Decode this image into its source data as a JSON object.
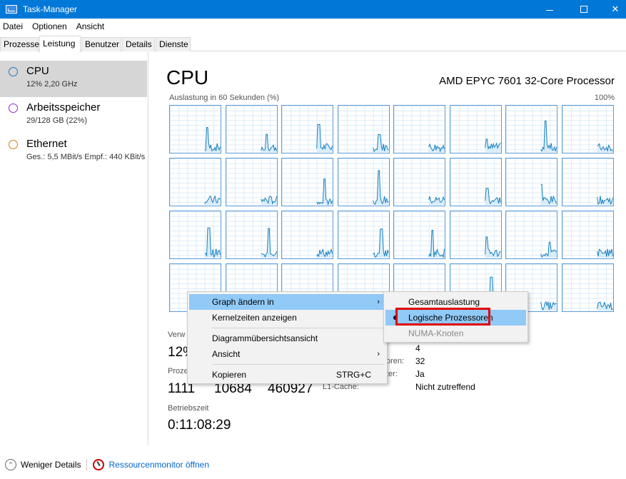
{
  "window": {
    "title": "Task-Manager"
  },
  "menubar": {
    "items": [
      "Datei",
      "Optionen",
      "Ansicht"
    ]
  },
  "tabs": [
    "Prozesse",
    "Leistung",
    "Benutzer",
    "Details",
    "Dienste"
  ],
  "sidebar": {
    "items": [
      {
        "name": "CPU",
        "sub": "12%  2,20 GHz",
        "color": "#1a7bc4"
      },
      {
        "name": "Arbeitsspeicher",
        "sub": "29/128 GB (22%)",
        "color": "#8b2fc9"
      },
      {
        "name": "Ethernet",
        "sub": "Ges.: 5,5 MBit/s  Empf.: 440 KBit/s",
        "color": "#d67a1c"
      }
    ]
  },
  "main": {
    "title": "CPU",
    "model": "AMD EPYC 7601 32-Core Processor",
    "graph_label": "Auslastung in 60 Sekunden (%)",
    "graph_max": "100%"
  },
  "stats": {
    "util_label": "Verw",
    "util_value": "12%",
    "proc_label": "Proze",
    "proc_value": "1111",
    "threads_value": "10684",
    "handles_value": "460927",
    "uptime_label": "Betriebszeit",
    "uptime_value": "0:11:08:29"
  },
  "kv": [
    {
      "label": "",
      "value": "4"
    },
    {
      "label": "oren:",
      "value": "32"
    },
    {
      "label": "ter:",
      "value": "Ja"
    },
    {
      "label": "L1-Cache:",
      "value": "Nicht zutreffend"
    }
  ],
  "context_menu": {
    "items": [
      "Graph ändern in",
      "Kernelzeiten anzeigen",
      "Diagrammübersichtsansicht",
      "Ansicht",
      "Kopieren"
    ],
    "copy_shortcut": "STRG+C"
  },
  "submenu": {
    "items": [
      "Gesamtauslastung",
      "Logische Prozessoren",
      "NUMA-Knoten"
    ]
  },
  "footer": {
    "fewer_details": "Weniger Details",
    "resmon": "Ressourcenmonitor öffnen"
  }
}
